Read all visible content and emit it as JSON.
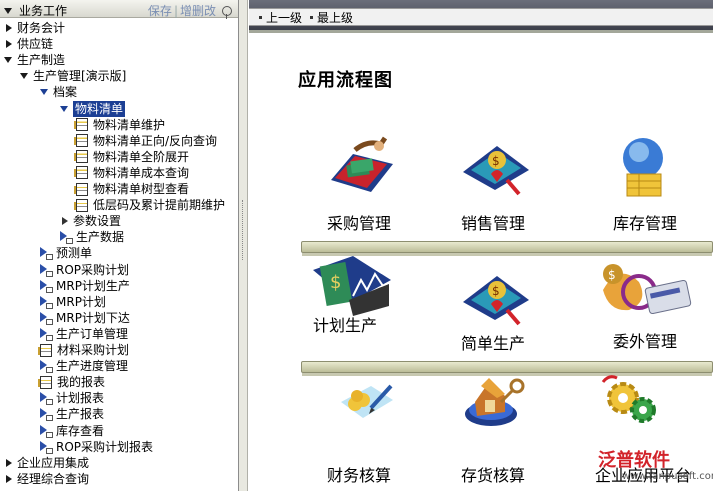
{
  "left_panel": {
    "title": "业务工作",
    "save_link": "保存",
    "separator": "|",
    "add_link": "增删改"
  },
  "tree": [
    {
      "label": "财务会计",
      "level": 0,
      "toggle": "closed",
      "icon": "none"
    },
    {
      "label": "供应链",
      "level": 0,
      "toggle": "closed",
      "icon": "none"
    },
    {
      "label": "生产制造",
      "level": 0,
      "toggle": "open",
      "icon": "none"
    },
    {
      "label": "生产管理[演示版]",
      "level": 1,
      "toggle": "open",
      "icon": "none"
    },
    {
      "label": "档案",
      "level": 2,
      "toggle": "open",
      "icon": "none"
    },
    {
      "label": "物料清单",
      "level": 3,
      "toggle": "open",
      "icon": "none",
      "selected": true
    },
    {
      "label": "物料清单维护",
      "level": 4,
      "toggle": "none",
      "icon": "doc"
    },
    {
      "label": "物料清单正向/反向查询",
      "level": 4,
      "toggle": "none",
      "icon": "doc"
    },
    {
      "label": "物料清单全阶展开",
      "level": 4,
      "toggle": "none",
      "icon": "doc"
    },
    {
      "label": "物料清单成本查询",
      "level": 4,
      "toggle": "none",
      "icon": "doc"
    },
    {
      "label": "物料清单树型查看",
      "level": 4,
      "toggle": "none",
      "icon": "doc"
    },
    {
      "label": "低层码及累计提前期维护",
      "level": 4,
      "toggle": "none",
      "icon": "doc"
    },
    {
      "label": "参数设置",
      "level": 3,
      "toggle": "closed",
      "icon": "none"
    },
    {
      "label": "生产数据",
      "level": 3,
      "toggle": "none",
      "icon": "folder"
    },
    {
      "label": "预测单",
      "level": 2,
      "toggle": "none",
      "icon": "folder"
    },
    {
      "label": "ROP采购计划",
      "level": 2,
      "toggle": "none",
      "icon": "folder"
    },
    {
      "label": "MRP计划生产",
      "level": 2,
      "toggle": "none",
      "icon": "folder"
    },
    {
      "label": "MRP计划",
      "level": 2,
      "toggle": "none",
      "icon": "folder"
    },
    {
      "label": "MRP计划下达",
      "level": 2,
      "toggle": "none",
      "icon": "folder"
    },
    {
      "label": "生产订单管理",
      "level": 2,
      "toggle": "none",
      "icon": "folder"
    },
    {
      "label": "材料采购计划",
      "level": 2,
      "toggle": "none",
      "icon": "doc"
    },
    {
      "label": "生产进度管理",
      "level": 2,
      "toggle": "none",
      "icon": "folder"
    },
    {
      "label": "我的报表",
      "level": 2,
      "toggle": "none",
      "icon": "doc"
    },
    {
      "label": "计划报表",
      "level": 2,
      "toggle": "none",
      "icon": "folder"
    },
    {
      "label": "生产报表",
      "level": 2,
      "toggle": "none",
      "icon": "folder"
    },
    {
      "label": "库存查看",
      "level": 2,
      "toggle": "none",
      "icon": "folder"
    },
    {
      "label": "ROP采购计划报表",
      "level": 2,
      "toggle": "none",
      "icon": "folder"
    },
    {
      "label": "企业应用集成",
      "level": 0,
      "toggle": "closed-arrow",
      "icon": "none"
    },
    {
      "label": "经理综合查询",
      "level": 0,
      "toggle": "closed-arrow",
      "icon": "none"
    }
  ],
  "toolbar": {
    "up_label": "上一级",
    "top_label": "最上级"
  },
  "main": {
    "title": "应用流程图",
    "modules": [
      {
        "label": "采购管理",
        "icon": "purchase-icon"
      },
      {
        "label": "销售管理",
        "icon": "sales-icon"
      },
      {
        "label": "库存管理",
        "icon": "inventory-icon"
      },
      {
        "label": "计划生产",
        "icon": "plan-production-icon"
      },
      {
        "label": "简单生产",
        "icon": "simple-production-icon"
      },
      {
        "label": "委外管理",
        "icon": "outsourcing-icon"
      },
      {
        "label": "财务核算",
        "icon": "financial-accounting-icon"
      },
      {
        "label": "存货核算",
        "icon": "stock-accounting-icon"
      },
      {
        "label": "企业应用平台",
        "icon": "enterprise-platform-icon"
      }
    ]
  },
  "watermark": {
    "brand": "泛普软件",
    "url": "www.fanpusoft.com"
  },
  "colors": {
    "selection": "#1c3f94",
    "link": "#7b8fb3",
    "toolbar_dark": "#3c3f4a",
    "shelf": "#bcbd98",
    "watermark": "#d2232a"
  }
}
